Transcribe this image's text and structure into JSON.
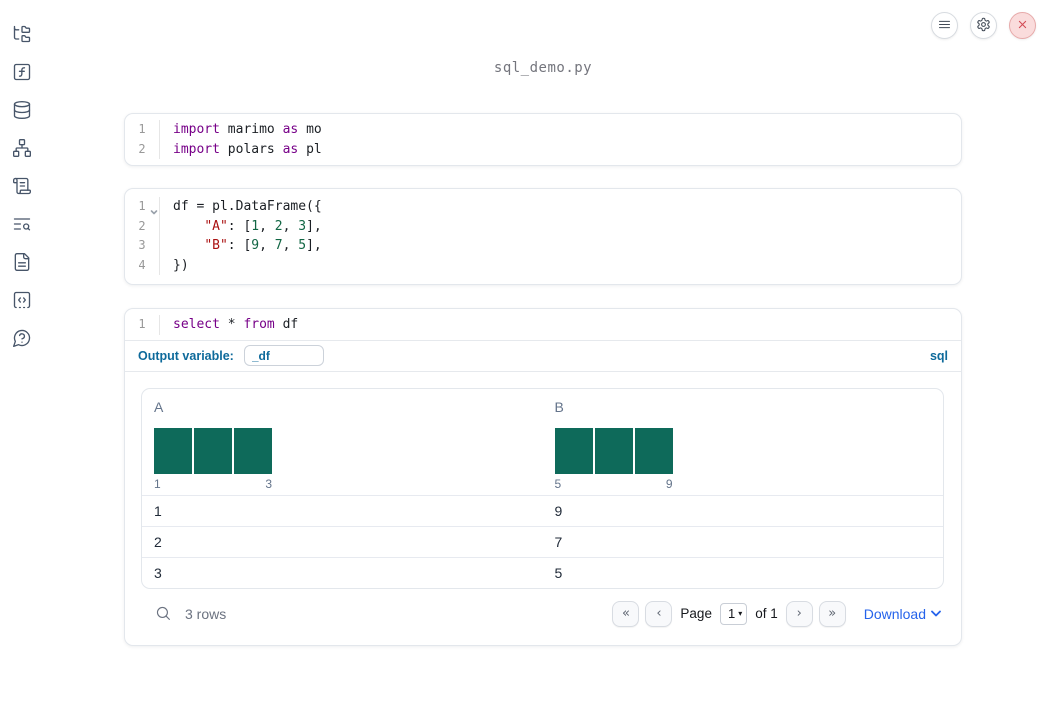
{
  "window": {
    "title": "sql_demo.py"
  },
  "colors": {
    "keyword": "#770088",
    "string": "#aa1111",
    "number": "#116644",
    "histogram-bar": "#0e6a5a",
    "accent-blue": "#0e6a9b",
    "link-blue": "#2563eb",
    "close-red": "#d24b55"
  },
  "topbar": {
    "icons": [
      "menu-icon",
      "settings-gear-icon",
      "shutdown-close-icon"
    ]
  },
  "sidebar": {
    "icons": [
      "file-explorer-tree-icon",
      "functions-icon",
      "datasources-database-icon",
      "dependency-graph-icon",
      "scratchpad-scroll-icon",
      "logs-search-icon",
      "documentation-file-icon",
      "snippets-code-icon",
      "help-chat-icon"
    ]
  },
  "code": {
    "cell1": {
      "line_numbers": [
        "1",
        "2"
      ],
      "lines": [
        {
          "tokens": [
            {
              "t": "import"
            },
            {
              "t": " marimo "
            },
            {
              "t": "as"
            },
            {
              "t": " mo"
            }
          ]
        },
        {
          "tokens": [
            {
              "t": "import"
            },
            {
              "t": " polars "
            },
            {
              "t": "as"
            },
            {
              "t": " pl"
            }
          ]
        }
      ]
    },
    "cell2": {
      "line_numbers": [
        "1",
        "2",
        "3",
        "4"
      ],
      "lines": [
        {
          "tokens": [
            {
              "t": "df = pl.DataFrame({"
            }
          ]
        },
        {
          "tokens": [
            {
              "t": "    "
            },
            {
              "t": "\"A\""
            },
            {
              "t": ": ["
            },
            {
              "t": "1"
            },
            {
              "t": ", "
            },
            {
              "t": "2"
            },
            {
              "t": ", "
            },
            {
              "t": "3"
            },
            {
              "t": "],"
            }
          ]
        },
        {
          "tokens": [
            {
              "t": "    "
            },
            {
              "t": "\"B\""
            },
            {
              "t": ": ["
            },
            {
              "t": "9"
            },
            {
              "t": ", "
            },
            {
              "t": "7"
            },
            {
              "t": ", "
            },
            {
              "t": "5"
            },
            {
              "t": "],"
            }
          ]
        },
        {
          "tokens": [
            {
              "t": "})"
            }
          ]
        }
      ]
    },
    "sqlcell": {
      "line_numbers": [
        "1"
      ],
      "lines": [
        {
          "tokens": [
            {
              "t": "select"
            },
            {
              "t": " * "
            },
            {
              "t": "from"
            },
            {
              "t": " df"
            }
          ]
        }
      ]
    }
  },
  "sql_cell": {
    "output_variable_label": "Output variable:",
    "output_variable_value": "_df",
    "language_badge": "sql"
  },
  "table": {
    "columns": [
      {
        "name": "A",
        "hist": {
          "bar_count": 3,
          "bar_values": [
            1,
            1,
            1
          ],
          "min_label": "1",
          "max_label": "3"
        }
      },
      {
        "name": "B",
        "hist": {
          "bar_count": 3,
          "bar_values": [
            1,
            1,
            1
          ],
          "min_label": "5",
          "max_label": "9"
        }
      }
    ],
    "rows": [
      [
        "1",
        "9"
      ],
      [
        "2",
        "7"
      ],
      [
        "3",
        "5"
      ]
    ],
    "footer": {
      "row_count": "3 rows",
      "pagination": {
        "first": "«",
        "prev": "‹",
        "page_label": "Page",
        "page_value": "1",
        "caret": "▾",
        "of_label": "of 1",
        "next": "›",
        "last": "»"
      },
      "download_label": "Download"
    }
  }
}
